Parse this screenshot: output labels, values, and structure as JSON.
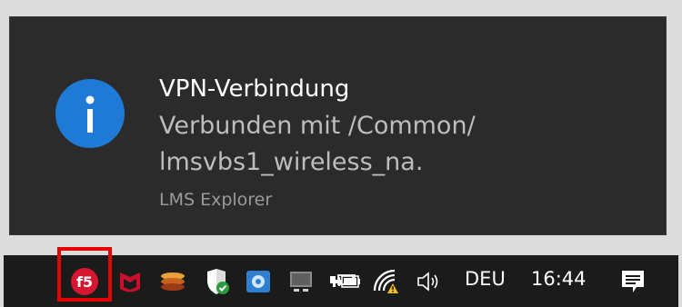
{
  "notification": {
    "title": "VPN-Verbindung",
    "body_line1": "Verbunden mit /Common/",
    "body_line2": "lmsvbs1_wireless_na.",
    "attribution": "LMS Explorer",
    "icon": "info-icon",
    "accent_color": "#1f7ad6"
  },
  "taskbar": {
    "tray_icons": [
      {
        "name": "f5-vpn-icon",
        "highlighted": true,
        "highlight_color": "#e40000"
      },
      {
        "name": "mcafee-icon"
      },
      {
        "name": "stack-app-icon"
      },
      {
        "name": "security-shield-icon"
      },
      {
        "name": "network-gear-icon"
      },
      {
        "name": "intel-graphics-icon"
      },
      {
        "name": "projector-icon"
      },
      {
        "name": "battery-plug-icon"
      },
      {
        "name": "wifi-warning-icon"
      },
      {
        "name": "speaker-icon"
      }
    ],
    "language": "DEU",
    "clock": "16:44",
    "action_center_icon": "notification-icon"
  }
}
